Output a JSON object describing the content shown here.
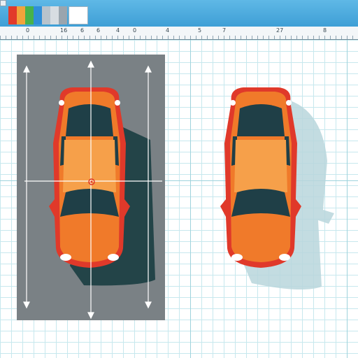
{
  "toolbar": {
    "swatches": [
      {
        "icon": "color-swatch",
        "color": "#e23a2a"
      },
      {
        "icon": "color-swatch",
        "color": "#f2a33b"
      },
      {
        "icon": "color-swatch",
        "color": "#47b24b"
      },
      {
        "icon": "color-swatch",
        "color": "#2f8fd9"
      },
      {
        "icon": "color-swatch",
        "color": "#b8c3cc"
      },
      {
        "icon": "color-swatch",
        "color": "#d7dde2"
      },
      {
        "icon": "color-swatch",
        "color": "#9aa5ae"
      }
    ],
    "selected_swatch_color": "#ffffff"
  },
  "ruler": {
    "labels": [
      "0",
      "16",
      "6",
      "6",
      "4",
      "0",
      "4",
      "5",
      "7",
      "27",
      "8"
    ]
  },
  "colors": {
    "car_body": "#f07a2a",
    "car_highlight": "#f6a04a",
    "car_outline": "#e0392a",
    "glass": "#1f3f47",
    "shadow": "#234448",
    "panel": "#7a8185",
    "grid": "#c7e8ee"
  },
  "icons": {
    "crosshair": "target-crosshair-icon",
    "arrows": "dimension-arrow-icon"
  }
}
